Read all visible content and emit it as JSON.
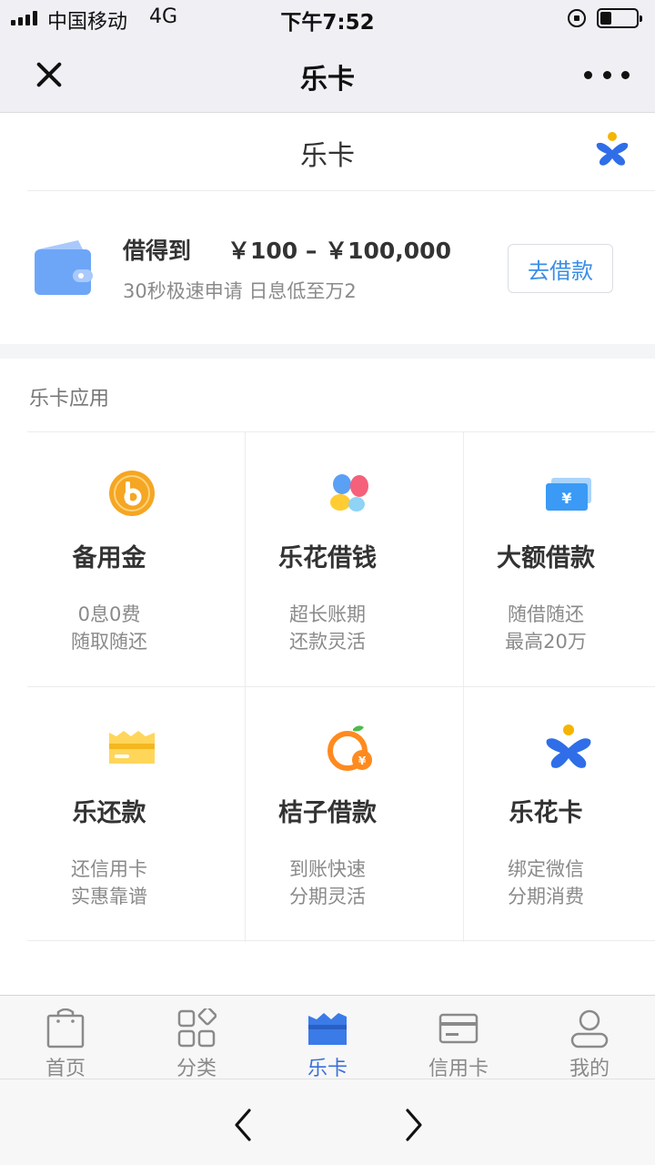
{
  "status_bar": {
    "carrier": "中国移动",
    "network": "4G",
    "time": "下午7:52"
  },
  "nav": {
    "title": "乐卡"
  },
  "header": {
    "title": "乐卡"
  },
  "loan": {
    "label": "借得到",
    "range": "￥100 – ￥100,000",
    "subtitle": "30秒极速申请 日息低至万2",
    "button": "去借款"
  },
  "apps": {
    "section_title": "乐卡应用",
    "items": [
      {
        "name": "备用金",
        "line1": "0息0费",
        "line2": "随取随还",
        "icon": "coin-b-icon"
      },
      {
        "name": "乐花借钱",
        "line1": "超长账期",
        "line2": "还款灵活",
        "icon": "petals-icon"
      },
      {
        "name": "大额借款",
        "line1": "随借随还",
        "line2": "最高20万",
        "icon": "cash-icon"
      },
      {
        "name": "乐还款",
        "line1": "还信用卡",
        "line2": "实惠靠谱",
        "icon": "card-icon"
      },
      {
        "name": "桔子借款",
        "line1": "到账快速",
        "line2": "分期灵活",
        "icon": "orange-icon"
      },
      {
        "name": "乐花卡",
        "line1": "绑定微信",
        "line2": "分期消费",
        "icon": "lehua-card-icon"
      }
    ]
  },
  "tabs": [
    {
      "label": "首页",
      "icon": "shopping-bag-icon"
    },
    {
      "label": "分类",
      "icon": "category-grid-icon"
    },
    {
      "label": "乐卡",
      "icon": "leka-card-icon",
      "active": true
    },
    {
      "label": "信用卡",
      "icon": "credit-card-icon"
    },
    {
      "label": "我的",
      "icon": "user-icon"
    }
  ],
  "colors": {
    "accent_blue": "#3a8ee6",
    "active_tab": "#3a6fd8",
    "orange": "#f5a623",
    "muted_text": "#8a8a8a"
  }
}
